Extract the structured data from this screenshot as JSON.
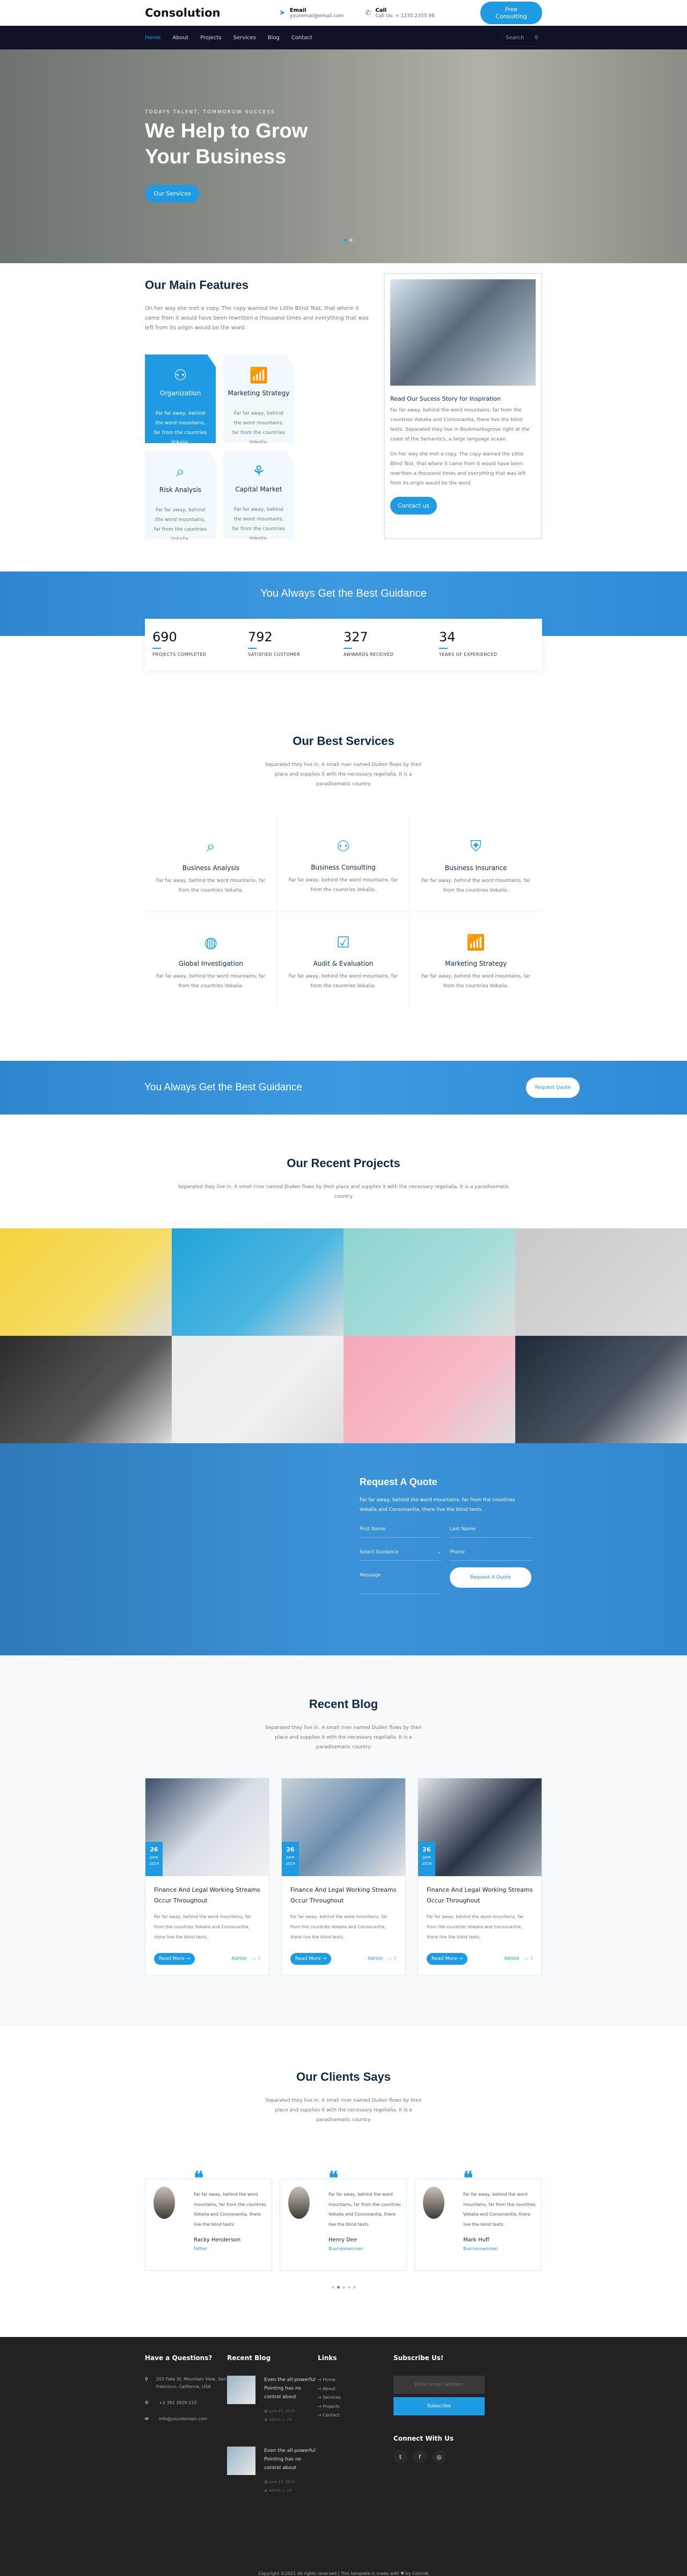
{
  "header": {
    "logo": "Consolution",
    "email_title": "Email",
    "email_value": "youremail@email.com",
    "call_title": "Call",
    "call_value": "Call Us: + 1235 2355 98",
    "cta": "Free Consulting"
  },
  "nav": {
    "items": [
      "Home",
      "About",
      "Projects",
      "Services",
      "Blog",
      "Contact"
    ],
    "active": "Home",
    "search_placeholder": "Search"
  },
  "hero": {
    "kicker": "TODAYS TALENT, TOMMOROW SUCCESS",
    "title_line1": "We Help to Grow",
    "title_line2": "Your Business",
    "button": "Our Services",
    "slides": 2,
    "active_slide": 1
  },
  "features": {
    "title": "Our Main Features",
    "text": "On her way she met a copy. The copy warned the Little Blind Text, that where it came from it would have been rewritten a thousand times and everything that was left from its origin would be the word.",
    "cards": [
      {
        "icon": "organization-icon",
        "title": "Organization",
        "text": "Far far away, behind the word mountains, far from the countries Vokalia."
      },
      {
        "icon": "marketing-chart-icon",
        "title": "Marketing Strategy",
        "text": "Far far away, behind the word mountains, far from the countries Vokalia."
      },
      {
        "icon": "risk-analysis-icon",
        "title": "Risk Analysis",
        "text": "Far far away, behind the word mountains, far from the countries Vokalia."
      },
      {
        "icon": "capital-market-icon",
        "title": "Capital Market",
        "text": "Far far away, behind the word mountains, far from the countries Vokalia."
      }
    ],
    "story": {
      "title": "Read Our Sucess Story for Inspiration",
      "p1": "Far far away, behind the word mountains, far from the countries Vokalia and Consonantia, there live the blind texts. Separated they live in Bookmarksgrove right at the coast of the Semantics, a large language ocean.",
      "p2": "On her way she met a copy. The copy warned the Little Blind Text, that where it came from it would have been rewritten a thousand times and everything that was left from its origin would be the word.",
      "button": "Contact us"
    }
  },
  "guidance": {
    "title": "You Always Get the Best Guidance",
    "stats": [
      {
        "value": "690",
        "label": "PROJECTS COMPLETED"
      },
      {
        "value": "792",
        "label": "SATISFIED CUSTOMER"
      },
      {
        "value": "327",
        "label": "AWWARDS RECEIVED"
      },
      {
        "value": "34",
        "label": "YEARS OF EXPERIENCED"
      }
    ]
  },
  "services": {
    "title": "Our Best Services",
    "subtitle": "Separated they live in. A small river named Duden flows by their place and supplies it with the necessary regelialia. It is a paradisematic country",
    "items": [
      {
        "icon": "analysis-icon",
        "title": "Business Analysis",
        "text": "Far far away, behind the word mountains, far from the countries Vokalia."
      },
      {
        "icon": "consulting-icon",
        "title": "Business Consulting",
        "text": "Far far away, behind the word mountains, far from the countries Vokalia."
      },
      {
        "icon": "insurance-shield-icon",
        "title": "Business Insurance",
        "text": "Far far away, behind the word mountains, far from the countries Vokalia."
      },
      {
        "icon": "globe-icon",
        "title": "Global Investigation",
        "text": "Far far away, behind the word mountains, far from the countries Vokalia."
      },
      {
        "icon": "audit-icon",
        "title": "Audit & Evaluation",
        "text": "Far far away, behind the word mountains, far from the countries Vokalia."
      },
      {
        "icon": "marketing-chart-icon",
        "title": "Marketing Strategy",
        "text": "Far far away, behind the word mountains, far from the countries Vokalia."
      }
    ]
  },
  "cta": {
    "title": "You Always Get the Best Guidance",
    "button": "Request Quote"
  },
  "projects": {
    "title": "Our Recent Projects",
    "subtitle": "Separated they live in. A small river named Duden flows by their place and supplies it with the necessary regelialia. It is a paradisematic country",
    "colors": [
      "#f3d33c",
      "#1fa3d9",
      "#8fd4cf",
      "#c9c9c9",
      "#2c2c2c",
      "#ececec",
      "#f5a8b8",
      "#1f2b3a"
    ]
  },
  "quote": {
    "title": "Request A Quote",
    "text": "Far far away, behind the word mountains, far from the countries Vokalia and Consonantia, there live the blind texts.",
    "first_name": "First Name",
    "last_name": "Last Name",
    "guidance": "Select Guidance",
    "phone": "Phone",
    "message": "Message",
    "button": "Request A Quote"
  },
  "blog": {
    "title": "Recent Blog",
    "subtitle": "Separated they live in. A small river named Duden flows by their place and supplies it with the necessary regelialia. It is a paradisematic country",
    "posts": [
      {
        "day": "26",
        "month": "June",
        "year": "2019",
        "title": "Finance And Legal Working Streams Occur Throughout",
        "text": "Far far away, behind the word mountains, far from the countries Vokalia and Consonantia, there live the blind texts.",
        "button": "Read More →",
        "author": "Admin",
        "comments": "3"
      },
      {
        "day": "26",
        "month": "June",
        "year": "2019",
        "title": "Finance And Legal Working Streams Occur Throughout",
        "text": "Far far away, behind the word mountains, far from the countries Vokalia and Consonantia, there live the blind texts.",
        "button": "Read More →",
        "author": "Admin",
        "comments": "3"
      },
      {
        "day": "26",
        "month": "June",
        "year": "2019",
        "title": "Finance And Legal Working Streams Occur Throughout",
        "text": "Far far away, behind the word mountains, far from the countries Vokalia and Consonantia, there live the blind texts.",
        "button": "Read More →",
        "author": "Admin",
        "comments": "3"
      }
    ]
  },
  "clients": {
    "title": "Our Clients Says",
    "subtitle": "Separated they live in. A small river named Duden flows by their place and supplies it with the necessary regelialia. It is a paradisematic country",
    "items": [
      {
        "text": "Far far away, behind the word mountains, far from the countries Vokalia and Consonantia, there live the blind texts.",
        "name": "Racky Henderson",
        "role": "Father"
      },
      {
        "text": "Far far away, behind the word mountains, far from the countries Vokalia and Consonantia, there live the blind texts.",
        "name": "Henry Dee",
        "role": "Businesswoman"
      },
      {
        "text": "Far far away, behind the word mountains, far from the countries Vokalia and Consonantia, there live the blind texts.",
        "name": "Mark Huff",
        "role": "Businesswoman"
      }
    ],
    "dots": 5,
    "active_dot": 2
  },
  "footer": {
    "questions_title": "Have a Questions?",
    "address": "203 Fake St. Mountain View, San Francisco, California, USA",
    "phone": "+2 392 3929 210",
    "email": "info@yourdomain.com",
    "blog_title": "Recent Blog",
    "blog_posts": [
      {
        "title": "Even the all-powerful Pointing has no control about",
        "date": "June 27, 2019",
        "author": "Admin",
        "comments": "19"
      },
      {
        "title": "Even the all-powerful Pointing has no control about",
        "date": "June 27, 2019",
        "author": "Admin",
        "comments": "19"
      }
    ],
    "links_title": "Links",
    "links": [
      "Home",
      "About",
      "Services",
      "Projects",
      "Contact"
    ],
    "subscribe_title": "Subscribe Us!",
    "subscribe_placeholder": "Enter email address",
    "subscribe_button": "Subscribe",
    "connect_title": "Connect With Us",
    "social": [
      "twitter-icon",
      "facebook-icon",
      "instagram-icon"
    ],
    "copyright": "Copyright ©2021 All rights reserved | This template is made with ♥ by Colorlib"
  },
  "colors": {
    "accent": "#1e9be3",
    "nav_bg": "#0e1128",
    "footer_bg": "#222222",
    "heading": "#0f2a47"
  }
}
